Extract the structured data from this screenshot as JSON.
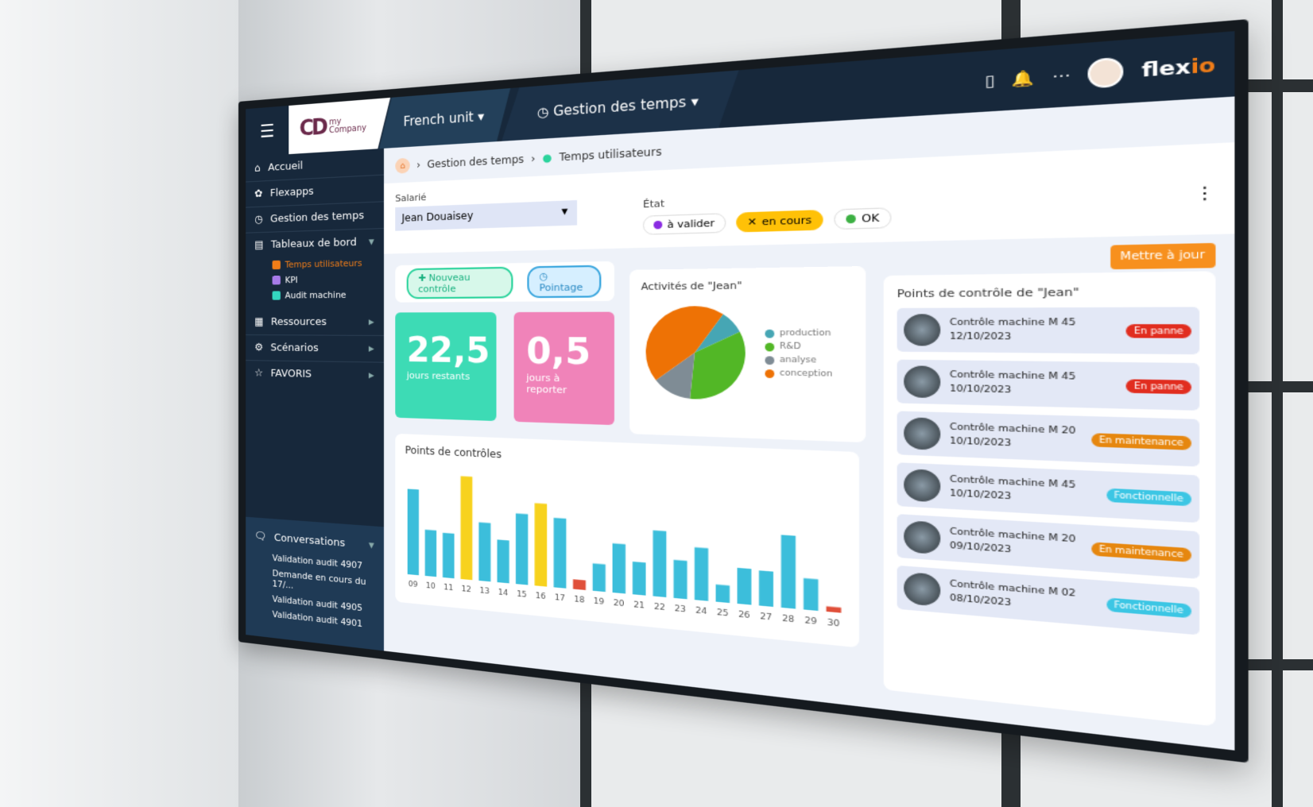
{
  "topbar": {
    "logo_text_1": "my",
    "logo_text_2": "Company",
    "logo_mark": "CD",
    "unit": "French unit",
    "module": "Gestion des temps",
    "brand_a": "flex",
    "brand_b": "io",
    "icons": [
      "tablet-icon",
      "bell-icon",
      "apps-grid-icon"
    ]
  },
  "sidebar": {
    "items": [
      {
        "label": "Accueil",
        "icon": "home-icon"
      },
      {
        "label": "Flexapps",
        "icon": "flexapps-icon"
      },
      {
        "label": "Gestion des temps",
        "icon": "clock-icon"
      },
      {
        "label": "Tableaux de bord",
        "icon": "chart-icon"
      }
    ],
    "subitems": [
      {
        "label": "Temps utilisateurs",
        "color": "#f07d18"
      },
      {
        "label": "KPI",
        "color": "#a77be8"
      },
      {
        "label": "Audit machine",
        "color": "#33d6c0"
      }
    ],
    "items2": [
      {
        "label": "Ressources",
        "icon": "table-icon"
      },
      {
        "label": "Scénarios",
        "icon": "gears-icon"
      },
      {
        "label": "FAVORIS",
        "icon": "star-icon"
      }
    ],
    "conversations": {
      "label": "Conversations",
      "items": [
        "Validation audit 4907",
        "Demande en cours du 17/...",
        "Validation audit 4905",
        "Validation audit 4901"
      ]
    }
  },
  "breadcrumb": [
    "Gestion des temps",
    "Temps utilisateurs"
  ],
  "filters": {
    "employee_label": "Salarié",
    "employee_value": "Jean Douaisey",
    "state_label": "État",
    "states": [
      {
        "label": "à valider",
        "color": "#8a2be2"
      },
      {
        "label": "en cours",
        "color": "#ffc107"
      },
      {
        "label": "OK",
        "color": "#3cb043"
      }
    ]
  },
  "actions": {
    "update": "Mettre à jour",
    "new_control": "Nouveau contrôle",
    "pointage": "Pointage"
  },
  "kpis": [
    {
      "value": "22,5",
      "label": "jours restants",
      "color": "#3ddbb5"
    },
    {
      "value": "0,5",
      "label": "jours à reporter",
      "color": "#f083b9"
    }
  ],
  "activities": {
    "title": "Activités de \"Jean\"",
    "chart_data": {
      "type": "pie",
      "slices": [
        {
          "name": "production",
          "value": 8,
          "color": "#46a6b4"
        },
        {
          "name": "R&D",
          "value": 34,
          "color": "#52b726"
        },
        {
          "name": "analyse",
          "value": 13,
          "color": "#7f8c95"
        },
        {
          "name": "conception",
          "value": 45,
          "color": "#ee7205"
        }
      ]
    }
  },
  "control_points": {
    "title": "Points de contrôle de \"Jean\"",
    "items": [
      {
        "name": "Contrôle machine M 45",
        "date": "12/10/2023",
        "status": "En panne",
        "color": "#e12d1f"
      },
      {
        "name": "Contrôle machine M 45",
        "date": "10/10/2023",
        "status": "En panne",
        "color": "#e12d1f"
      },
      {
        "name": "Contrôle machine M 20",
        "date": "10/10/2023",
        "status": "En maintenance",
        "color": "#e6870f"
      },
      {
        "name": "Contrôle machine M 45",
        "date": "10/10/2023",
        "status": "Fonctionnelle",
        "color": "#3cc6e4"
      },
      {
        "name": "Contrôle machine M 20",
        "date": "09/10/2023",
        "status": "En maintenance",
        "color": "#e6870f"
      },
      {
        "name": "Contrôle machine M 02",
        "date": "08/10/2023",
        "status": "Fonctionnelle",
        "color": "#3cc6e4"
      }
    ]
  },
  "chart_data": {
    "type": "bar",
    "title": "Points de contrôles",
    "categories": [
      "09",
      "10",
      "11",
      "12",
      "13",
      "14",
      "15",
      "16",
      "17",
      "18",
      "19",
      "20",
      "21",
      "22",
      "23",
      "24",
      "25",
      "26",
      "27",
      "28",
      "29",
      "30"
    ],
    "values": [
      93,
      50,
      48,
      110,
      62,
      45,
      74,
      86,
      72,
      10,
      28,
      50,
      33,
      66,
      38,
      52,
      17,
      35,
      34,
      70,
      30,
      5
    ],
    "colors": [
      "#3cbedb",
      "#3cbedb",
      "#3cbedb",
      "#f7d21e",
      "#3cbedb",
      "#3cbedb",
      "#3cbedb",
      "#f7d21e",
      "#3cbedb",
      "#e0503a",
      "#3cbedb",
      "#3cbedb",
      "#3cbedb",
      "#3cbedb",
      "#3cbedb",
      "#3cbedb",
      "#3cbedb",
      "#3cbedb",
      "#3cbedb",
      "#3cbedb",
      "#3cbedb",
      "#e0503a"
    ],
    "grid": false
  }
}
